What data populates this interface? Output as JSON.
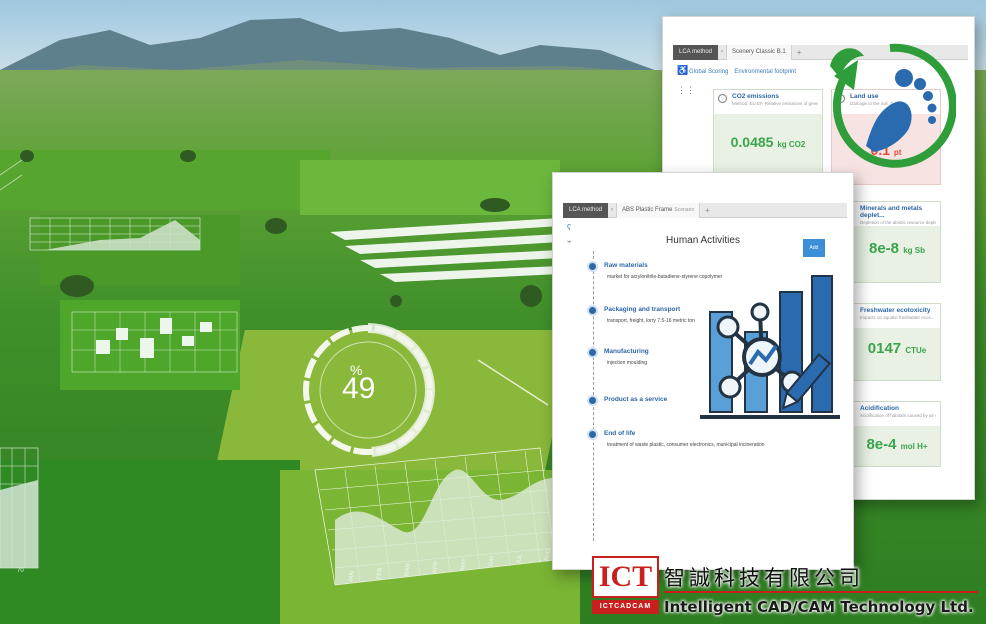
{
  "overlay": {
    "gauge_symbol": "%",
    "gauge_value": "49",
    "gauge_percent": 49,
    "chart_months": [
      "JAN",
      "FEB",
      "MAR",
      "APR",
      "MAY",
      "JUN",
      "JUL",
      "AUG"
    ],
    "left_chart_label": "70"
  },
  "back_panel": {
    "tab_method": "LCA method",
    "tab_case": "Scenery Classic B.1",
    "subnav_first": "Global Scoring",
    "subnav_second": "Environmental footprint",
    "metrics": [
      {
        "title": "CO2 emissions",
        "desc": "Method: EU EF. Relative emissions of greenh...",
        "value": "0.0485",
        "unit": "kg CO2"
      },
      {
        "title": "Land use",
        "desc": "Damage to the soil, due to...",
        "value": "0.1",
        "unit": "pt"
      },
      {
        "title": "Minerals and metals deplet...",
        "desc": "Depletion of the abiotic resource depletion...",
        "value": "8e-8",
        "unit": "kg Sb"
      },
      {
        "title": "Freshwater ecotoxicity",
        "desc": "Impacts on aquatic freshwater ecos...",
        "value": "0147",
        "unit": "CTUe"
      },
      {
        "title": "Acidification",
        "desc": "Acidification of habitats caused by air emis...",
        "value": "8e-4",
        "unit": "mol H+"
      }
    ],
    "colors": {
      "good": "#3ba54a",
      "bad": "#e34a3a",
      "accent": "#2d67a8"
    }
  },
  "front_panel": {
    "tab_method": "LCA method",
    "tab_case": "ABS Plastic Frame",
    "tab_case_sub": "Scenario",
    "title": "Human Activities",
    "button_label": "Add",
    "stages": [
      {
        "label": "Raw materials",
        "sub": "market for acrylonitrile-butadiene-styrene copolymer"
      },
      {
        "label": "Packaging and transport",
        "sub": "transport, freight, lorry 7.5-16 metric ton"
      },
      {
        "label": "Manufacturing",
        "sub": "injection moulding"
      },
      {
        "label": "Product as a service",
        "sub": ""
      },
      {
        "label": "End of life",
        "sub": "treatment of waste plastic, consumer electronics, municipal incineration"
      }
    ]
  },
  "icons": {
    "analytics": "network-bar-chart-pencil-icon",
    "eco": "footprint-recycle-icon"
  },
  "logo": {
    "mark": "ICT",
    "mark_sub": "ICTCADCAM",
    "chinese": "智誠科技有限公司",
    "english": "Intelligent CAD/CAM Technology Ltd.",
    "brand_red": "#c8201d"
  }
}
